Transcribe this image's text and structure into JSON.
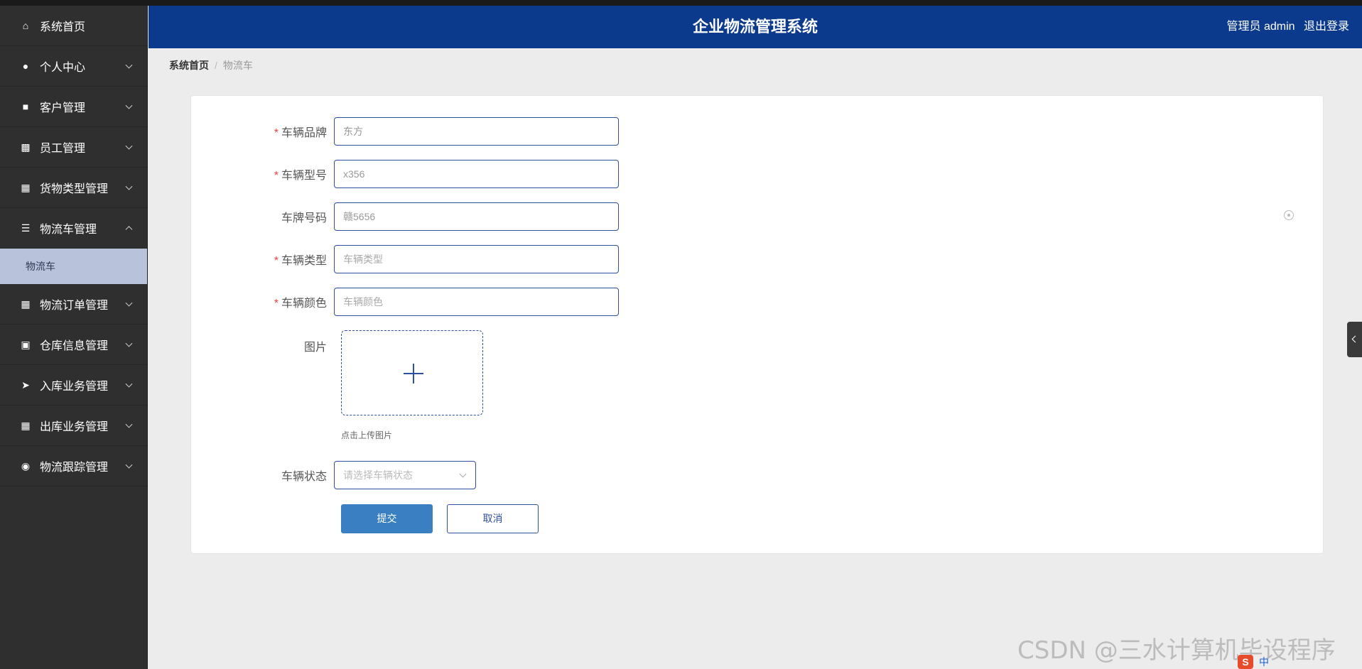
{
  "header": {
    "title": "企业物流管理系统",
    "user_label": "管理员 admin",
    "logout_label": "退出登录"
  },
  "sidebar": {
    "items": [
      {
        "label": "系统首页",
        "icon": "home-icon",
        "expanded": false,
        "has_children": false
      },
      {
        "label": "个人中心",
        "icon": "user-icon",
        "expanded": false,
        "has_children": true
      },
      {
        "label": "客户管理",
        "icon": "customer-icon",
        "expanded": false,
        "has_children": true
      },
      {
        "label": "员工管理",
        "icon": "chat-icon",
        "expanded": false,
        "has_children": true
      },
      {
        "label": "货物类型管理",
        "icon": "grid-icon",
        "expanded": false,
        "has_children": true
      },
      {
        "label": "物流车管理",
        "icon": "list-icon",
        "expanded": true,
        "has_children": true
      },
      {
        "label": "物流订单管理",
        "icon": "grid-icon",
        "expanded": false,
        "has_children": true
      },
      {
        "label": "仓库信息管理",
        "icon": "clipboard-icon",
        "expanded": false,
        "has_children": true
      },
      {
        "label": "入库业务管理",
        "icon": "send-icon",
        "expanded": false,
        "has_children": true
      },
      {
        "label": "出库业务管理",
        "icon": "table-icon",
        "expanded": false,
        "has_children": true
      },
      {
        "label": "物流跟踪管理",
        "icon": "bulb-icon",
        "expanded": false,
        "has_children": true
      }
    ],
    "submenu": {
      "label": "物流车"
    }
  },
  "breadcrumb": {
    "home": "系统首页",
    "separator": "/",
    "current": "物流车"
  },
  "form": {
    "brand": {
      "label": "车辆品牌",
      "required": true,
      "value": "东方"
    },
    "model": {
      "label": "车辆型号",
      "required": true,
      "value": "x356"
    },
    "plate": {
      "label": "车牌号码",
      "required": false,
      "value": "赣5656"
    },
    "type": {
      "label": "车辆类型",
      "required": true,
      "placeholder": "车辆类型"
    },
    "color": {
      "label": "车辆颜色",
      "required": true,
      "placeholder": "车辆颜色"
    },
    "image": {
      "label": "图片",
      "hint": "点击上传图片"
    },
    "status": {
      "label": "车辆状态",
      "placeholder": "请选择车辆状态"
    },
    "submit_label": "提交",
    "cancel_label": "取消"
  },
  "watermark": "CSDN @三水计算机毕设程序",
  "ime": {
    "logo": "S",
    "mode": "中"
  },
  "colors": {
    "header_bg": "#0b3a8c",
    "sidebar_bg": "#2f2f2f",
    "submenu_active_bg": "#b8c2db",
    "primary_button": "#3a7fc1",
    "required_star": "#e04545"
  }
}
